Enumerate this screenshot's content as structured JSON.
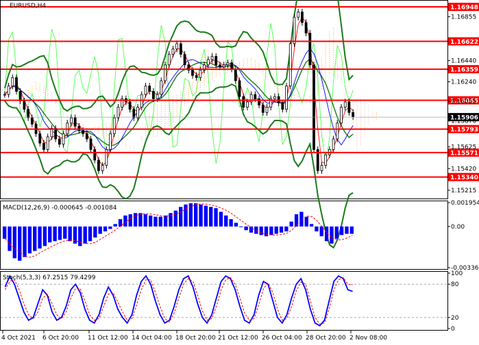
{
  "main_panel": {
    "title": "EURUSD,H4",
    "price_axis_ticks": [
      "1.16855",
      "1.16440",
      "1.16240",
      "1.16055",
      "1.15870",
      "1.15625",
      "1.15420",
      "1.15215"
    ],
    "current_price": "1.15906",
    "levels": [
      "1.16948",
      "1.16622",
      "1.16359",
      "1.16065",
      "1.15793",
      "1.15571",
      "1.15340"
    ],
    "colors": {
      "level_line": "#ff0000",
      "level_tag": "#ff0000",
      "price_tag": "#000000",
      "bollinger": "#1a7a1a",
      "ma_fast": "#ff0000",
      "ma_slow": "#0000ff",
      "rsi_like": "#33ff33",
      "cloud_orange": "#ff8c00",
      "cloud_pink": "#ff9999"
    }
  },
  "macd_panel": {
    "title": "MACD(12,26,9) -0.000645 -0.001084",
    "axis_ticks": [
      "0.001954",
      "0.00",
      "-0.003369"
    ],
    "colors": {
      "histogram": "#0000ff",
      "signal": "#ff0000"
    }
  },
  "stoch_panel": {
    "title": "Stoch(5,3,3) 67.2515 79.4299",
    "axis_ticks": [
      "100",
      "80",
      "20",
      "0"
    ],
    "colors": {
      "main": "#0000ff",
      "signal": "#ff0000"
    }
  },
  "time_axis": [
    "4 Oct 2021",
    "6 Oct 20:00",
    "11 Oct 12:00",
    "14 Oct 04:00",
    "18 Oct 20:00",
    "21 Oct 12:00",
    "26 Oct 04:00",
    "28 Oct 20:00",
    "2 Nov 08:00"
  ],
  "chart_data": [
    {
      "type": "candlestick",
      "title": "EURUSD,H4",
      "ylim": [
        1.1515,
        1.17
      ],
      "horizontal_levels": [
        1.16948,
        1.16622,
        1.16359,
        1.16065,
        1.15793,
        1.15571,
        1.1534
      ],
      "last_price": 1.15906,
      "close": [
        1.1612,
        1.162,
        1.1628,
        1.1615,
        1.1606,
        1.1598,
        1.159,
        1.1584,
        1.1575,
        1.1566,
        1.156,
        1.1572,
        1.158,
        1.157,
        1.1565,
        1.1575,
        1.1585,
        1.159,
        1.1582,
        1.1578,
        1.1575,
        1.157,
        1.156,
        1.155,
        1.154,
        1.1545,
        1.156,
        1.1575,
        1.159,
        1.16,
        1.1608,
        1.1605,
        1.1598,
        1.159,
        1.16,
        1.1612,
        1.162,
        1.1615,
        1.1608,
        1.1612,
        1.1625,
        1.164,
        1.165,
        1.1655,
        1.166,
        1.165,
        1.164,
        1.1635,
        1.163,
        1.1628,
        1.1635,
        1.164,
        1.1645,
        1.1648,
        1.164,
        1.1638,
        1.164,
        1.1642,
        1.1636,
        1.1625,
        1.161,
        1.16,
        1.1605,
        1.1612,
        1.1608,
        1.1602,
        1.1595,
        1.16,
        1.1608,
        1.161,
        1.1604,
        1.1598,
        1.162,
        1.166,
        1.1685,
        1.169,
        1.168,
        1.167,
        1.164,
        1.156,
        1.154,
        1.1545,
        1.1555,
        1.156,
        1.157,
        1.1585,
        1.16,
        1.1605,
        1.1595,
        1.1591
      ]
    },
    {
      "type": "bar",
      "title": "MACD(12,26,9) -0.000645 -0.001084",
      "ylim": [
        -0.003369,
        0.001954
      ],
      "histogram": [
        -0.001,
        -0.002,
        -0.0026,
        -0.0028,
        -0.0025,
        -0.0022,
        -0.002,
        -0.0018,
        -0.0016,
        -0.0013,
        -0.0012,
        -0.0011,
        -0.001,
        -0.0012,
        -0.0014,
        -0.0016,
        -0.0014,
        -0.0012,
        -0.0009,
        -0.0006,
        -0.0004,
        -0.0002,
        0.0002,
        0.0006,
        0.0009,
        0.001,
        0.0011,
        0.0011,
        0.001,
        0.0009,
        0.0008,
        0.0008,
        0.0009,
        0.0011,
        0.0013,
        0.0016,
        0.0018,
        0.0019,
        0.0019,
        0.0018,
        0.0017,
        0.0016,
        0.0015,
        0.0012,
        0.0009,
        0.0006,
        0.0003,
        0.0,
        -0.0003,
        -0.0005,
        -0.0006,
        -0.0007,
        -0.0008,
        -0.0007,
        -0.0006,
        -0.0005,
        -0.0004,
        0.0004,
        0.001,
        0.0012,
        0.0008,
        0.0002,
        -0.0004,
        -0.0008,
        -0.0012,
        -0.0014,
        -0.001,
        -0.0007,
        -0.0006,
        -0.0006
      ]
    },
    {
      "type": "line",
      "title": "Stoch(5,3,3) 67.2515 79.4299",
      "ylim": [
        0,
        100
      ],
      "series": [
        {
          "values": [
            75,
            95,
            80,
            55,
            30,
            15,
            20,
            45,
            70,
            60,
            30,
            15,
            20,
            40,
            70,
            80,
            65,
            35,
            15,
            10,
            25,
            55,
            75,
            60,
            35,
            20,
            10,
            25,
            60,
            85,
            95,
            80,
            50,
            25,
            10,
            15,
            40,
            70,
            90,
            95,
            75,
            45,
            20,
            10,
            25,
            55,
            85,
            95,
            90,
            70,
            40,
            15,
            10,
            25,
            60,
            85,
            80,
            50,
            20,
            10,
            25,
            55,
            80,
            90,
            70,
            35,
            10,
            5,
            15,
            50,
            85,
            95,
            90,
            70,
            67
          ]
        },
        {
          "values": [
            70,
            85,
            88,
            70,
            45,
            25,
            18,
            30,
            55,
            62,
            45,
            25,
            18,
            30,
            55,
            72,
            72,
            50,
            25,
            15,
            18,
            40,
            62,
            65,
            48,
            30,
            15,
            18,
            42,
            70,
            88,
            88,
            65,
            40,
            18,
            12,
            28,
            55,
            80,
            90,
            85,
            60,
            32,
            15,
            18,
            40,
            70,
            88,
            92,
            80,
            55,
            28,
            15,
            18,
            42,
            72,
            82,
            65,
            35,
            15,
            18,
            40,
            68,
            84,
            80,
            50,
            20,
            8,
            10,
            35,
            70,
            88,
            92,
            80,
            79
          ]
        }
      ]
    }
  ]
}
